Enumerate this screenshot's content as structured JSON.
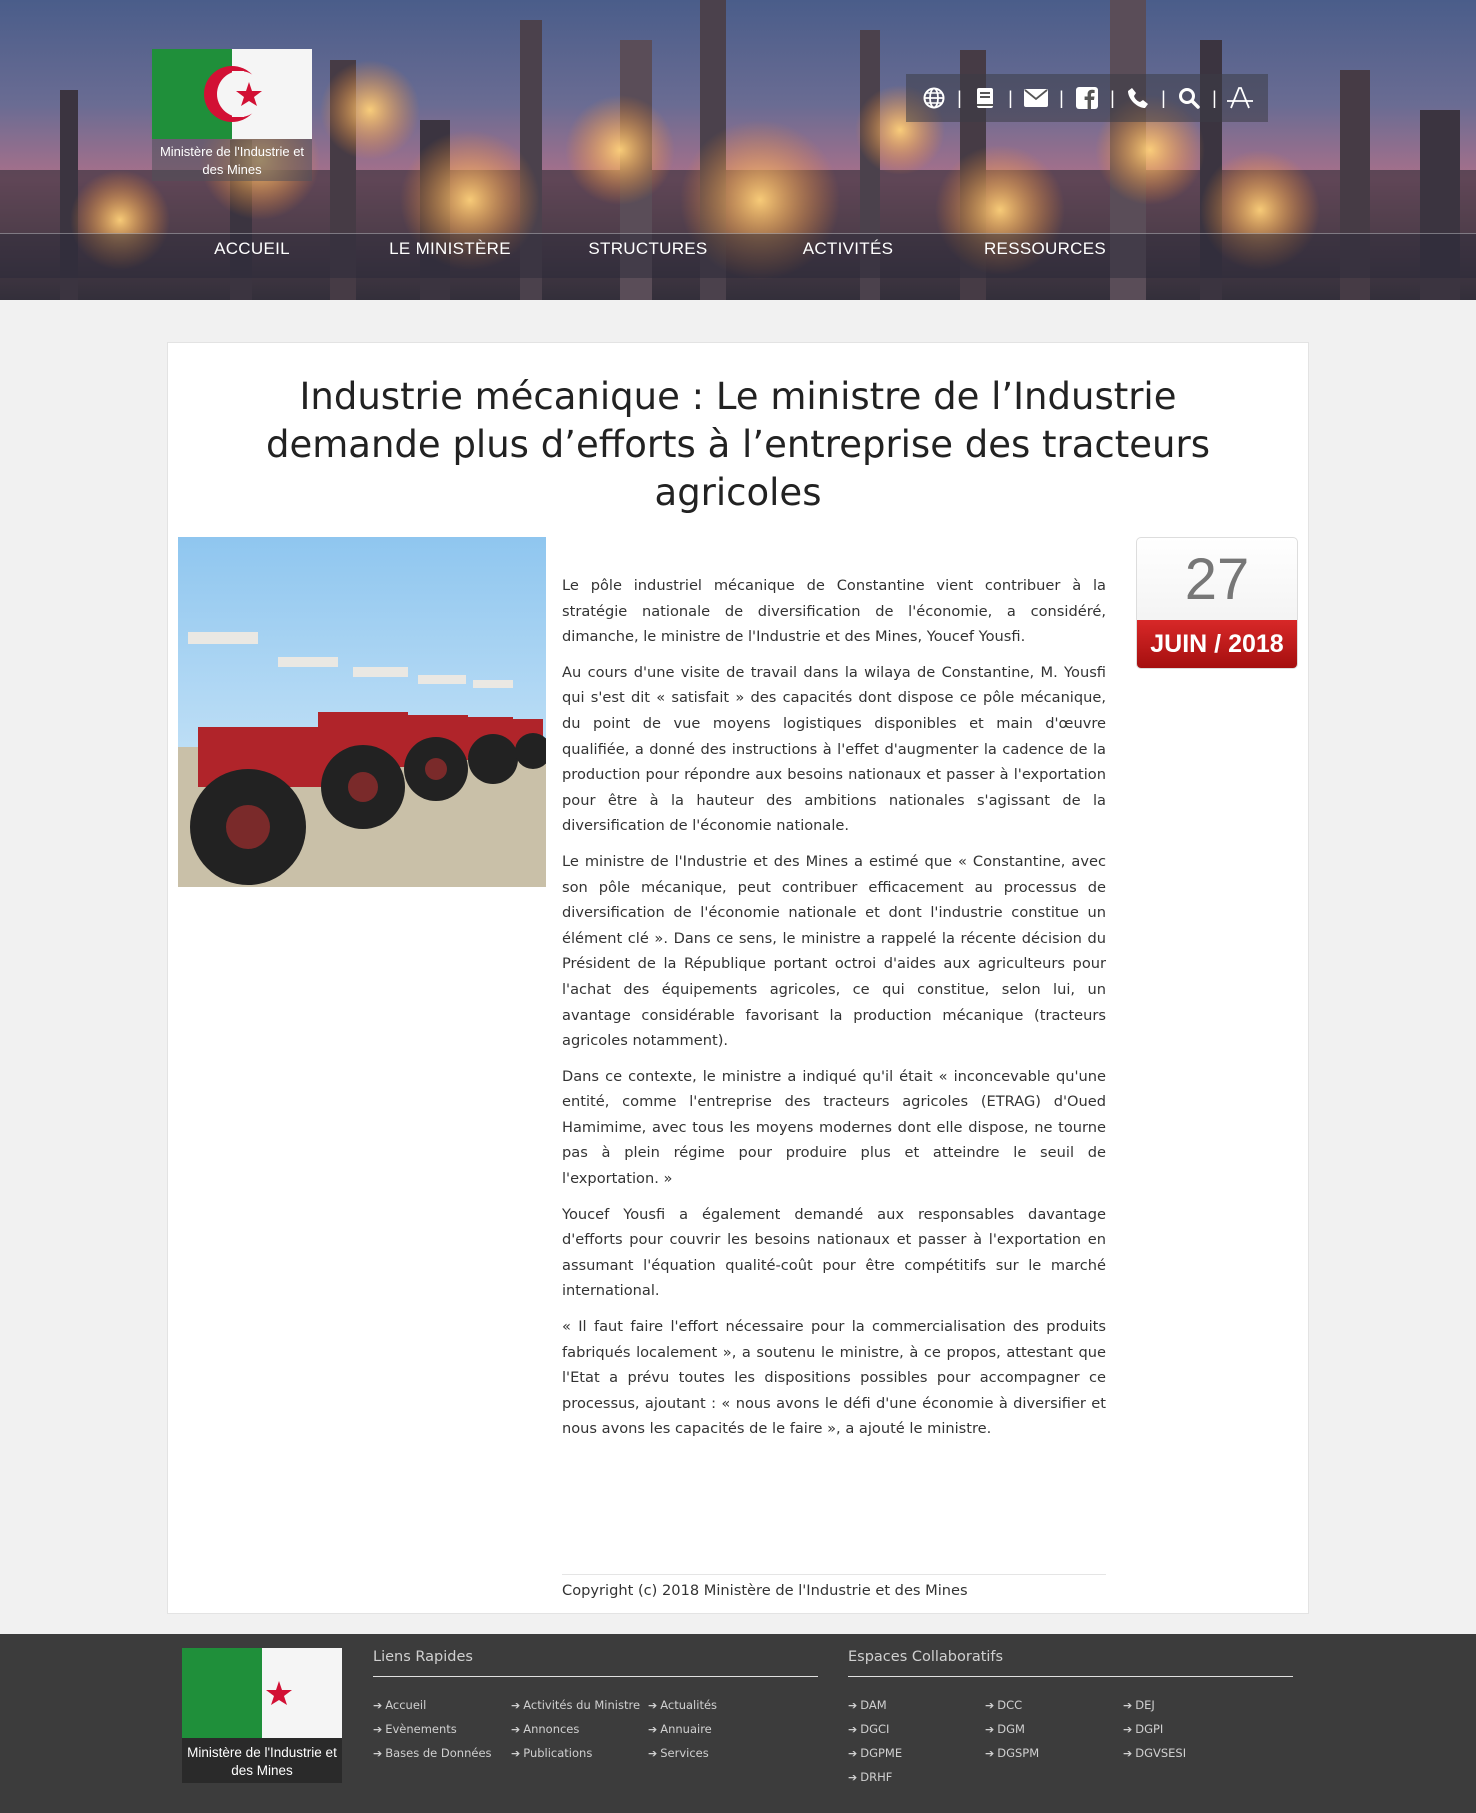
{
  "header": {
    "logo_caption": "Ministère de l'Industrie et des Mines",
    "toolbar_icons": [
      "globe-icon",
      "book-icon",
      "mail-icon",
      "facebook-icon",
      "phone-icon",
      "search-icon",
      "font-size-icon"
    ],
    "toolbar_separator": "|",
    "nav": [
      "ACCUEIL",
      "LE MINISTÈRE",
      "STRUCTURES",
      "ACTIVITÉS",
      "RESSOURCES"
    ]
  },
  "article": {
    "title": "Industrie mécanique : Le ministre de l’Industrie demande plus d’efforts à l’entreprise des tracteurs agricoles",
    "date_day": "27",
    "date_month_year": "JUIN / 2018",
    "paragraphs": [
      "Le pôle industriel mécanique de Constantine vient contribuer à la stratégie nationale de diversification de l'économie, a considéré, dimanche, le ministre de l'Industrie et des Mines, Youcef Yousfi.",
      "Au cours d'une visite de travail dans la wilaya de Constantine, M. Yousfi qui s'est dit « satisfait » des capacités dont dispose ce pôle mécanique, du point de vue moyens logistiques disponibles et main d'œuvre qualifiée, a donné des instructions à l'effet d'augmenter la cadence de la production pour répondre aux besoins nationaux et passer à l'exportation pour être à la hauteur des ambitions nationales s'agissant de la diversification de l'économie nationale.",
      "Le ministre de l'Industrie et des Mines a estimé que « Constantine, avec son pôle mécanique, peut contribuer efficacement au processus de diversification de l'économie nationale et dont l'industrie constitue un élément clé ». Dans ce sens, le ministre a rappelé la récente décision du Président de la République portant octroi d'aides aux agriculteurs pour l'achat des équipements agricoles, ce qui constitue, selon lui, un avantage considérable favorisant la production mécanique (tracteurs agricoles notamment).",
      "Dans ce contexte, le ministre a indiqué qu'il était « inconcevable qu'une entité, comme l'entreprise des tracteurs agricoles (ETRAG) d'Oued Hamimime, avec tous les moyens modernes dont elle dispose, ne tourne pas à plein régime pour produire plus et atteindre le seuil de l'exportation. »",
      "Youcef Yousfi a également demandé aux responsables davantage d'efforts pour couvrir les besoins nationaux et passer à l'exportation en assumant l'équation qualité-coût pour être compétitifs sur le marché international.",
      "« Il faut faire l'effort nécessaire pour la commercialisation des produits fabriqués localement », a soutenu le ministre, à ce propos, attestant que l'Etat a prévu toutes les dispositions possibles pour accompagner ce processus, ajoutant : « nous avons le défi d'une économie à diversifier et nous avons les capacités de le faire », a ajouté le ministre."
    ],
    "copyright": "Copyright (c) 2018 Ministère de l'Industrie et des Mines"
  },
  "footer": {
    "logo_caption": "Ministère de l'Industrie et des Mines",
    "arrow": "➔",
    "quick_links_title": "Liens Rapides",
    "quick_links": [
      "Accueil",
      "Activités du Ministre",
      "Actualités",
      "Evènements",
      "Annonces",
      "Annuaire",
      "Bases de Données",
      "Publications",
      "Services"
    ],
    "collab_title": "Espaces Collaboratifs",
    "collab_links": [
      "DAM",
      "DCC",
      "DEJ",
      "DGCI",
      "DGM",
      "DGPI",
      "DGPME",
      "DGSPM",
      "DGVSESI",
      "DRHF"
    ]
  },
  "colors": {
    "flag_green": "#1f8f3a",
    "flag_red": "#d21034",
    "date_red": "#c41a1a",
    "footer_bg": "#3c3c3c"
  }
}
